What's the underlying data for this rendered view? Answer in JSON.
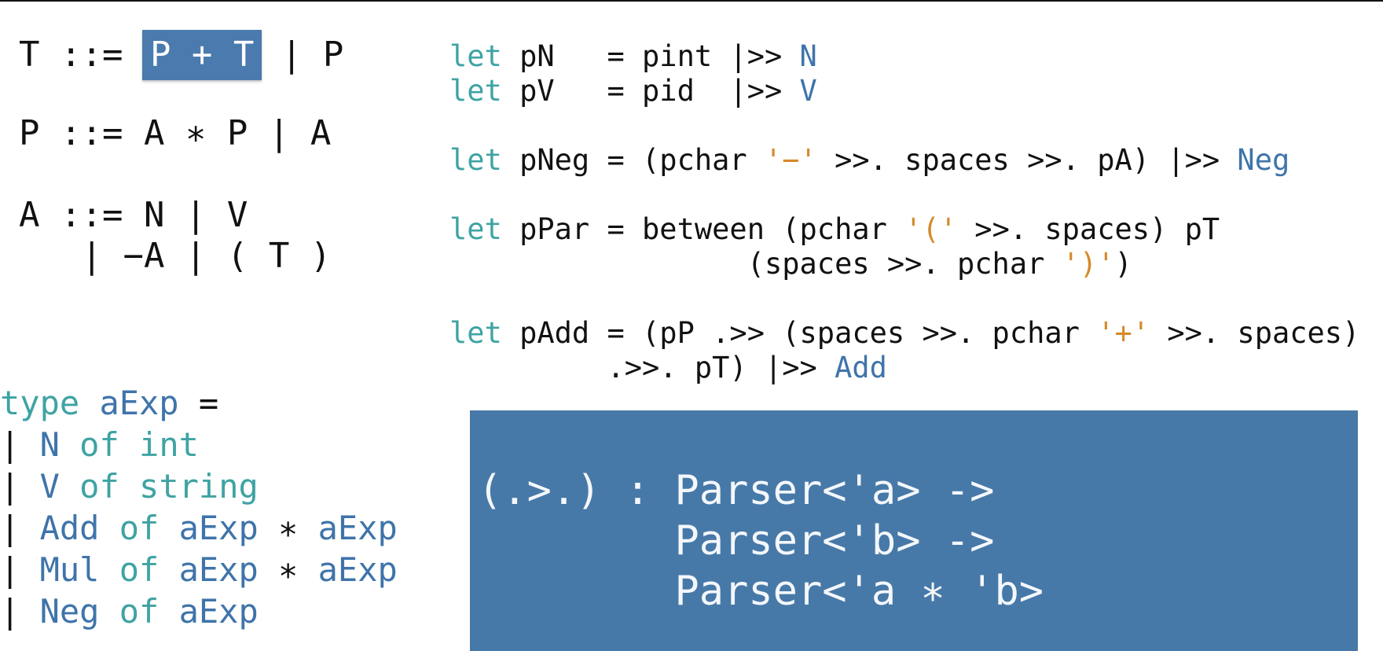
{
  "grammar": {
    "t_lhs": "T ::= ",
    "t_highlight": "P + T",
    "t_rest": " | P",
    "p_rule": "P ::= A ∗ P | A",
    "a_rule1": "A ::= N | V",
    "a_rule2": "   | −A | ( T )"
  },
  "code": {
    "kw": "let",
    "pN_a": " pN   = pint |>> ",
    "pN_ctor": "N",
    "pV_a": " pV   = pid  |>> ",
    "pV_ctor": "V",
    "pNeg_a": " pNeg = (pchar ",
    "pNeg_lit": "'−'",
    "pNeg_b": " >>. spaces >>. pA) |>> ",
    "pNeg_ctor": "Neg",
    "pPar_a": " pPar = between (pchar ",
    "pPar_lit1": "'('",
    "pPar_b": " >>. spaces) pT",
    "pPar_c": "                 (spaces >>. pchar ",
    "pPar_lit2": "')'",
    "pPar_d": ")",
    "pAdd_a": " pAdd = (pP .>> (spaces >>. pchar ",
    "pAdd_lit": "'+'",
    "pAdd_b": " >>. spaces)",
    "pAdd_c": "         .>>. pT) |>> ",
    "pAdd_ctor": "Add"
  },
  "type_def": {
    "type_kw": "type",
    "type_name": " aExp",
    "type_eq": " =",
    "bar": "| ",
    "of": "of",
    "star": " ∗ ",
    "aexp": "aExp",
    "cases": [
      {
        "ctor": "N",
        "arg": "int"
      },
      {
        "ctor": "V",
        "arg": "string"
      },
      {
        "ctor": "Add",
        "arg": "aExp"
      },
      {
        "ctor": "Mul",
        "arg": "aExp"
      },
      {
        "ctor": "Neg",
        "arg": "aExp"
      }
    ]
  },
  "signature_box": {
    "line1": "(.>.) : Parser<'a> ->",
    "line2": "        Parser<'b> ->",
    "line3": "        Parser<'a ∗ 'b>"
  },
  "colors": {
    "keyword": "#3fa3a3",
    "constructor": "#3f74aa",
    "string_literal": "#d58a2a",
    "highlight": "#4a7aae",
    "box": "#4779a8"
  }
}
